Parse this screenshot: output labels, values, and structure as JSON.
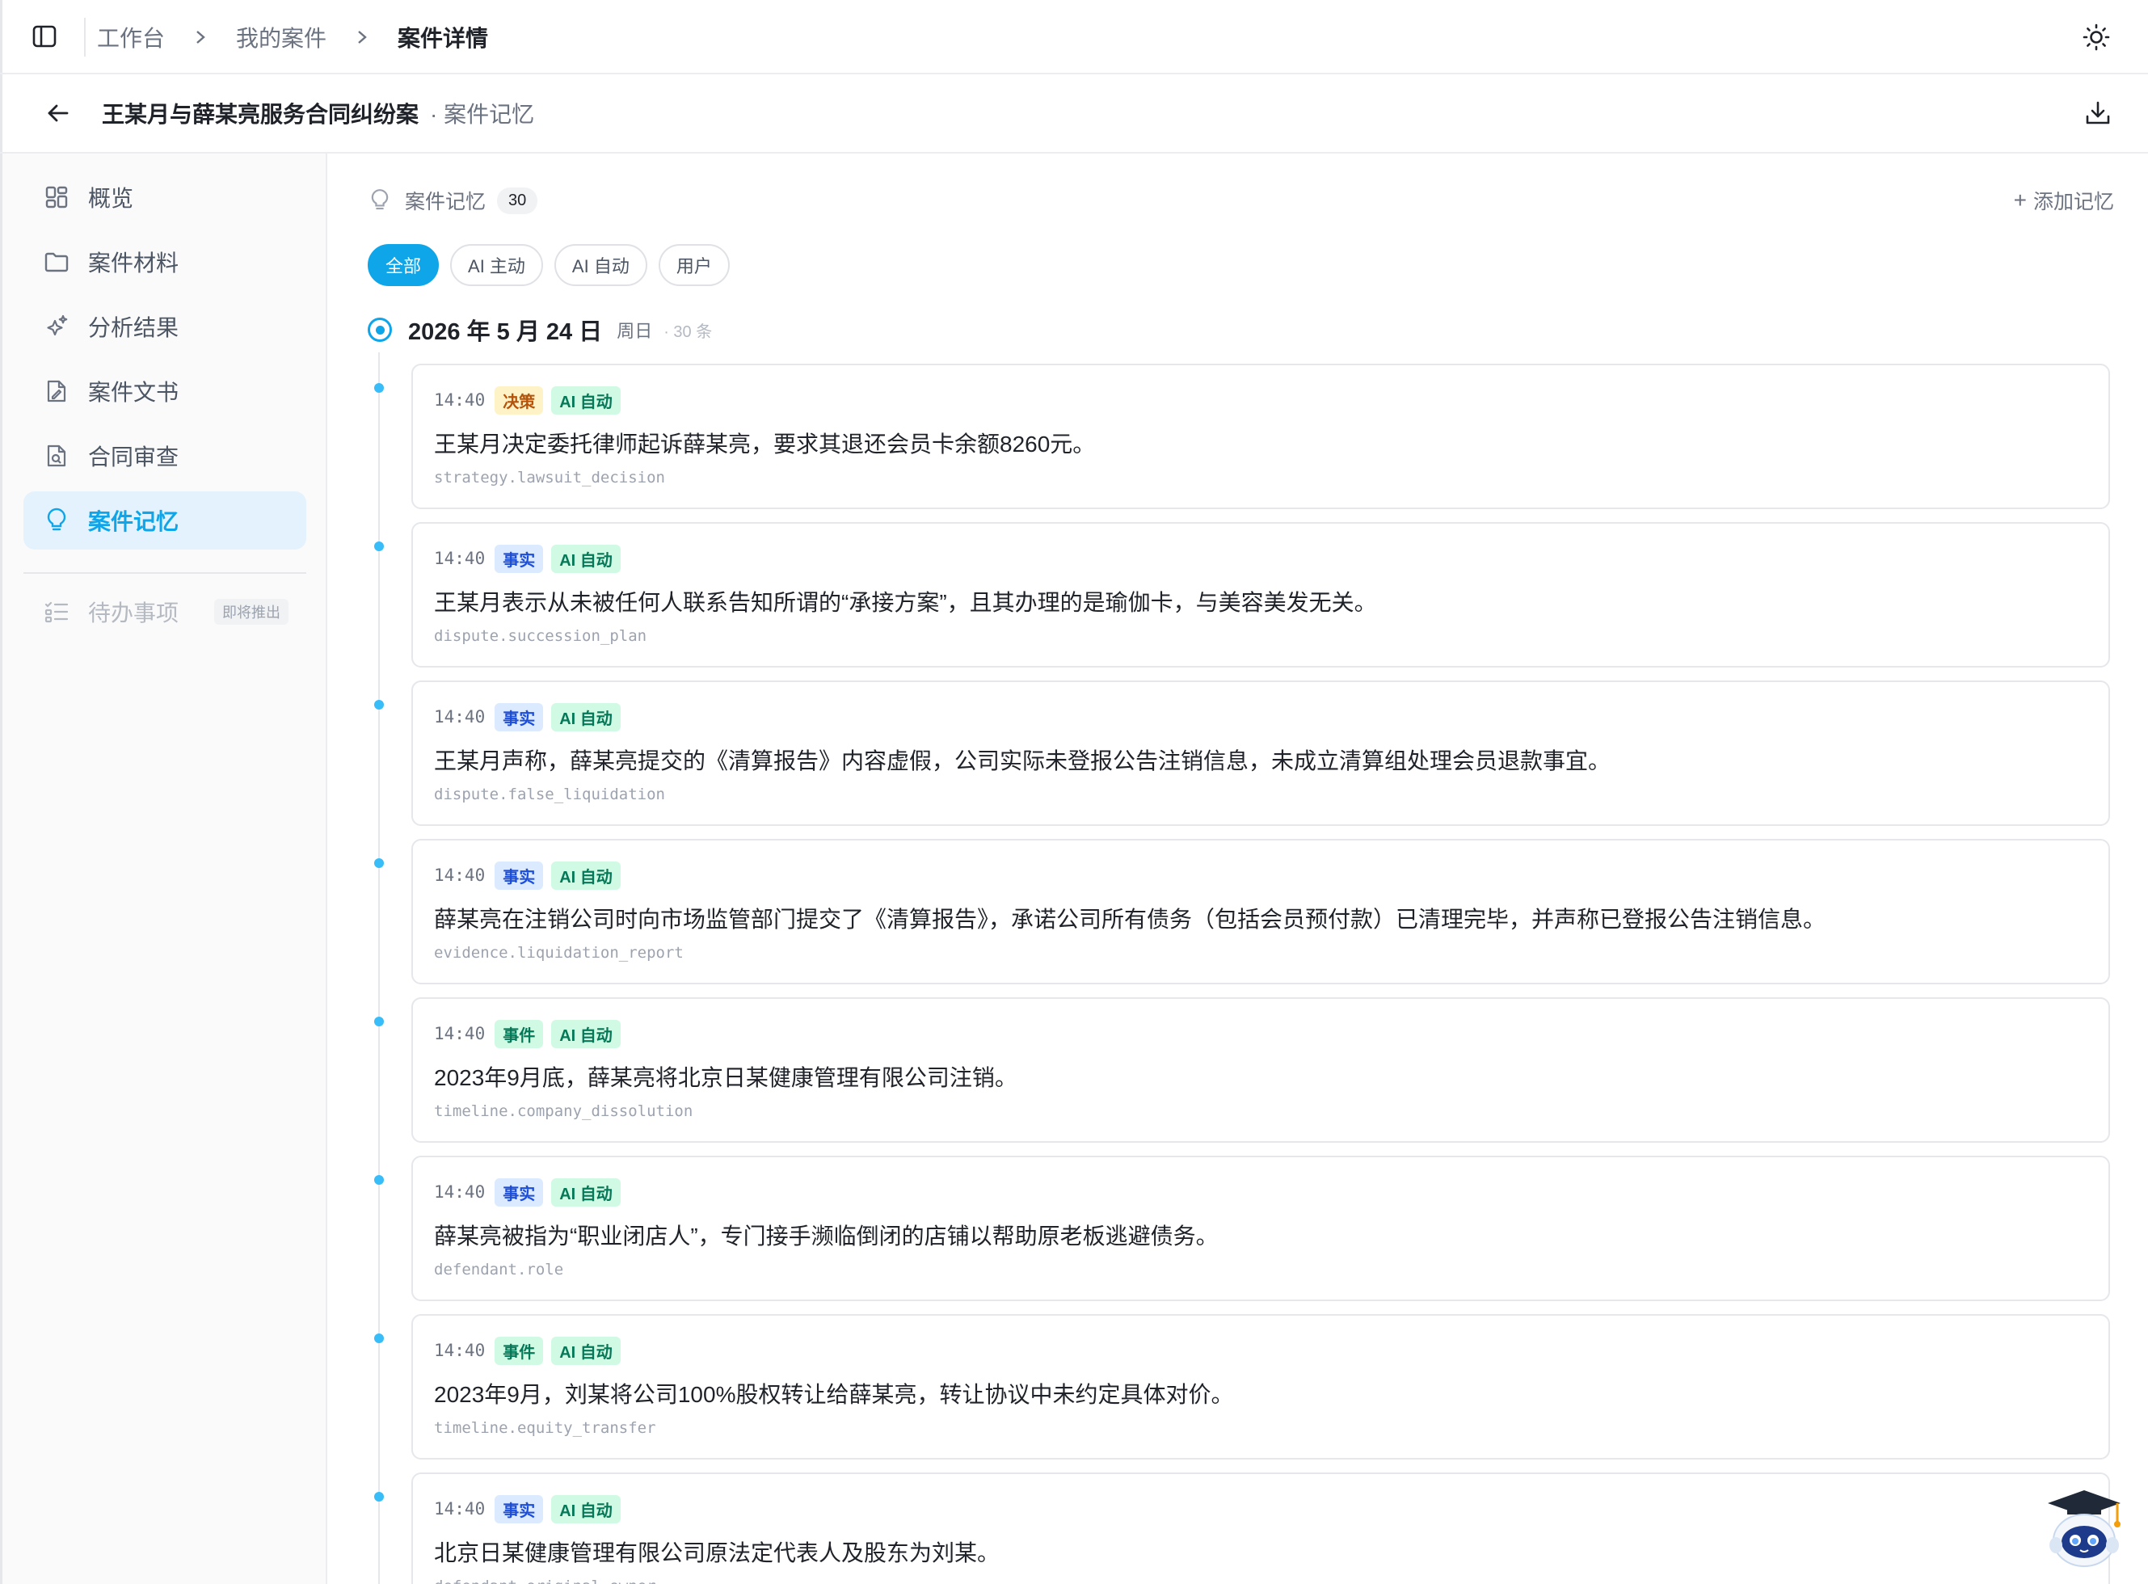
{
  "breadcrumb": [
    "工作台",
    "我的案件",
    "案件详情"
  ],
  "case": {
    "title": "王某月与薛某亮服务合同纠纷案",
    "subtitle": "· 案件记忆"
  },
  "sidebar": {
    "items": [
      {
        "label": "概览",
        "icon": "grid-icon"
      },
      {
        "label": "案件材料",
        "icon": "folder-icon"
      },
      {
        "label": "分析结果",
        "icon": "sparkles-icon"
      },
      {
        "label": "案件文书",
        "icon": "document-pen-icon"
      },
      {
        "label": "合同审查",
        "icon": "document-search-icon"
      },
      {
        "label": "案件记忆",
        "icon": "lightbulb-icon",
        "active": true
      }
    ],
    "todo": {
      "label": "待办事项",
      "badge": "即将推出",
      "icon": "checklist-icon"
    }
  },
  "memory": {
    "title": "案件记忆",
    "count": "30",
    "add_label": "添加记忆",
    "filters": [
      "全部",
      "AI 主动",
      "AI 自动",
      "用户"
    ],
    "active_filter": "全部",
    "date": "2026 年 5 月 24 日",
    "weekday": "周日",
    "day_count": "· 30 条",
    "entries": [
      {
        "time": "14:40",
        "category": "决策",
        "category_type": "decision",
        "source": "AI 自动",
        "text": "王某月决定委托律师起诉薛某亮，要求其退还会员卡余额8260元。",
        "key": "strategy.lawsuit_decision"
      },
      {
        "time": "14:40",
        "category": "事实",
        "category_type": "fact",
        "source": "AI 自动",
        "text": "王某月表示从未被任何人联系告知所谓的“承接方案”，且其办理的是瑜伽卡，与美容美发无关。",
        "key": "dispute.succession_plan"
      },
      {
        "time": "14:40",
        "category": "事实",
        "category_type": "fact",
        "source": "AI 自动",
        "text": "王某月声称，薛某亮提交的《清算报告》内容虚假，公司实际未登报公告注销信息，未成立清算组处理会员退款事宜。",
        "key": "dispute.false_liquidation"
      },
      {
        "time": "14:40",
        "category": "事实",
        "category_type": "fact",
        "source": "AI 自动",
        "text": "薛某亮在注销公司时向市场监管部门提交了《清算报告》，承诺公司所有债务（包括会员预付款）已清理完毕，并声称已登报公告注销信息。",
        "key": "evidence.liquidation_report"
      },
      {
        "time": "14:40",
        "category": "事件",
        "category_type": "event",
        "source": "AI 自动",
        "text": "2023年9月底，薛某亮将北京日某健康管理有限公司注销。",
        "key": "timeline.company_dissolution"
      },
      {
        "time": "14:40",
        "category": "事实",
        "category_type": "fact",
        "source": "AI 自动",
        "text": "薛某亮被指为“职业闭店人”，专门接手濒临倒闭的店铺以帮助原老板逃避债务。",
        "key": "defendant.role"
      },
      {
        "time": "14:40",
        "category": "事件",
        "category_type": "event",
        "source": "AI 自动",
        "text": "2023年9月，刘某将公司100%股权转让给薛某亮，转让协议中未约定具体对价。",
        "key": "timeline.equity_transfer"
      },
      {
        "time": "14:40",
        "category": "事实",
        "category_type": "fact",
        "source": "AI 自动",
        "text": "北京日某健康管理有限公司原法定代表人及股东为刘某。",
        "key": "defendant.original_owner"
      }
    ]
  },
  "colors": {
    "accent": "#0ea5e9",
    "active_bg": "#e3f2fd",
    "decision": "#b45309",
    "fact": "#1d4ed8",
    "event": "#047857"
  }
}
